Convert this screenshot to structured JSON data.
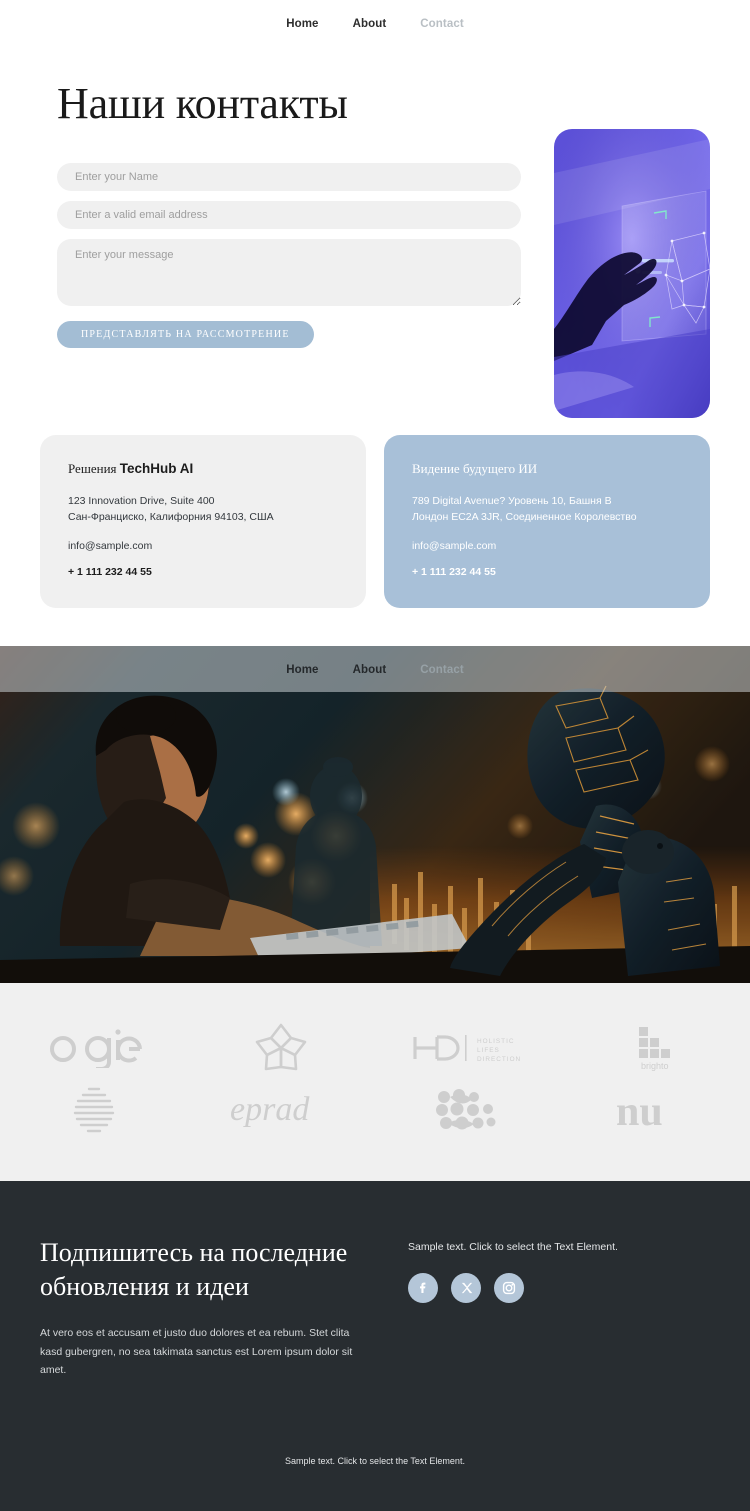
{
  "topnav": {
    "items": [
      {
        "label": "Home",
        "muted": false
      },
      {
        "label": "About",
        "muted": false
      },
      {
        "label": "Contact",
        "muted": true
      }
    ]
  },
  "hero": {
    "title": "Наши контакты",
    "form": {
      "name_placeholder": "Enter your Name",
      "email_placeholder": "Enter a valid email address",
      "message_placeholder": "Enter your message",
      "submit_label": "ПРЕДСТАВЛЯТЬ НА РАССМОТРЕНИЕ",
      "button_color": "#a3bdd4",
      "field_bg": "#f0f0f0"
    },
    "image_alt": "hand-touching-holographic-screen"
  },
  "cards": [
    {
      "title_prefix": "Решения",
      "title_brand": "TechHub AI",
      "address_line1": "123 Innovation Drive, Suite 400",
      "address_line2": "Сан-Франциско, Калифорния 94103, США",
      "email": "info@sample.com",
      "phone": "+ 1 111 232 44 55",
      "bg": "#f0f0f0"
    },
    {
      "title": "Видение будущего ИИ",
      "address_line1": "789 Digital Avenue? Уровень 10, Башня B",
      "address_line2": "Лондон EC2A 3JR, Соединенное Королевство",
      "email": "info@sample.com",
      "phone": "+ 1 111 232 44 55",
      "bg": "#a8c0d8"
    }
  ],
  "banner": {
    "nav": [
      {
        "label": "Home",
        "muted": false
      },
      {
        "label": "About",
        "muted": false
      },
      {
        "label": "Contact",
        "muted": true
      }
    ],
    "image_alt": "woman-working-with-humanoid-robot"
  },
  "logos": {
    "bg": "#f0f0f0",
    "row1": [
      {
        "name": "ogie",
        "type": "wordmark"
      },
      {
        "name": "flower-star",
        "type": "mark"
      },
      {
        "name": "HD Holistic Lifes Direction",
        "type": "hd",
        "line1": "HOLISTIC",
        "line2": "LIFES",
        "line3": "DIRECTION"
      },
      {
        "name": "brighto",
        "type": "brighto",
        "caption": "brighto"
      }
    ],
    "row2": [
      {
        "name": "striped-sphere",
        "type": "mark"
      },
      {
        "name": "eprad",
        "type": "script"
      },
      {
        "name": "dots-grid",
        "type": "mark"
      },
      {
        "name": "nu",
        "type": "wordmark"
      }
    ]
  },
  "footer": {
    "heading": "Подпишитесь на последние обновления и идеи",
    "body": "At vero eos et accusam et justo duo dolores et ea rebum. Stet clita kasd gubergren, no sea takimata sanctus est Lorem ipsum dolor sit amet.",
    "sample_text": "Sample text. Click to select the Text Element.",
    "socials": [
      {
        "name": "facebook",
        "glyph": "f"
      },
      {
        "name": "x-twitter",
        "glyph": "X"
      },
      {
        "name": "instagram",
        "glyph": "◎"
      }
    ],
    "bottom_text": "Sample text. Click to select the Text Element.",
    "bg": "#282d31",
    "social_bg": "#b4c6d8"
  }
}
